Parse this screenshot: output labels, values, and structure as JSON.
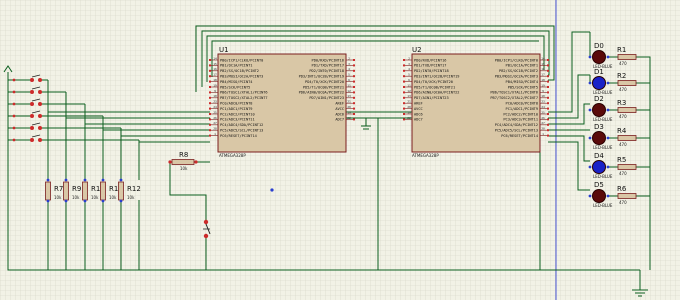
{
  "schematic": {
    "mcu1": {
      "ref": "U1",
      "part": "ATMEGA328P",
      "left_pins": [
        {
          "no": "14",
          "name": "PB0/ICP1/CLKO/PCINT0"
        },
        {
          "no": "15",
          "name": "PB1/OC1A/PCINT1"
        },
        {
          "no": "16",
          "name": "PB2/SS/OC1B/PCINT2"
        },
        {
          "no": "17",
          "name": "PB3/MOSI/OC2A/PCINT3"
        },
        {
          "no": "18",
          "name": "PB4/MISO/PCINT4"
        },
        {
          "no": "19",
          "name": "PB5/SCK/PCINT5"
        },
        {
          "no": "9",
          "name": "PB6/TOSC1/XTAL1/PCINT6"
        },
        {
          "no": "10",
          "name": "PB7/TOSC2/XTAL2/PCINT7"
        },
        {
          "no": "23",
          "name": "PC0/ADC0/PCINT8"
        },
        {
          "no": "24",
          "name": "PC1/ADC1/PCINT9"
        },
        {
          "no": "25",
          "name": "PC2/ADC2/PCINT10"
        },
        {
          "no": "26",
          "name": "PC3/ADC3/PCINT11"
        },
        {
          "no": "27",
          "name": "PC4/ADC4/SDA/PCINT12"
        },
        {
          "no": "28",
          "name": "PC5/ADC5/SCL/PCINT13"
        },
        {
          "no": "1",
          "name": "PC6/RESET/PCINT14"
        }
      ],
      "right_pins": [
        {
          "no": "2",
          "name": "PD0/RXD/PCINT16"
        },
        {
          "no": "3",
          "name": "PD1/TXD/PCINT17"
        },
        {
          "no": "4",
          "name": "PD2/INT0/PCINT18"
        },
        {
          "no": "5",
          "name": "PD3/INT1/OC2B/PCINT19"
        },
        {
          "no": "6",
          "name": "PD4/T0/XCK/PCINT20"
        },
        {
          "no": "11",
          "name": "PD5/T1/OC0B/PCINT21"
        },
        {
          "no": "12",
          "name": "PD6/AIN0/OC0A/PCINT22"
        },
        {
          "no": "13",
          "name": "PD7/AIN1/PCINT23"
        },
        {
          "no": "21",
          "name": "AREF"
        },
        {
          "no": "20",
          "name": "AVCC"
        },
        {
          "no": "19",
          "name": "ADC6"
        },
        {
          "no": "22",
          "name": "ADC7"
        }
      ]
    },
    "mcu2": {
      "ref": "U2",
      "part": "ATMEGA328P",
      "left_pins": [
        {
          "no": "2",
          "name": "PD0/RXD/PCINT16"
        },
        {
          "no": "3",
          "name": "PD1/TXD/PCINT17"
        },
        {
          "no": "4",
          "name": "PD2/INT0/PCINT18"
        },
        {
          "no": "5",
          "name": "PD3/INT1/OC2B/PCINT19"
        },
        {
          "no": "6",
          "name": "PD4/T0/XCK/PCINT20"
        },
        {
          "no": "11",
          "name": "PD5/T1/OC0B/PCINT21"
        },
        {
          "no": "12",
          "name": "PD6/AIN0/OC0A/PCINT22"
        },
        {
          "no": "13",
          "name": "PD7/AIN1/PCINT23"
        },
        {
          "no": "21",
          "name": "AREF"
        },
        {
          "no": "20",
          "name": "AVCC"
        },
        {
          "no": "19",
          "name": "ADC6"
        },
        {
          "no": "22",
          "name": "ADC7"
        }
      ],
      "right_pins": [
        {
          "no": "14",
          "name": "PB0/ICP1/CLKO/PCINT0"
        },
        {
          "no": "15",
          "name": "PB1/OC1A/PCINT1"
        },
        {
          "no": "16",
          "name": "PB2/SS/OC1B/PCINT2"
        },
        {
          "no": "17",
          "name": "PB3/MOSI/OC2A/PCINT3"
        },
        {
          "no": "18",
          "name": "PB4/MISO/PCINT4"
        },
        {
          "no": "19",
          "name": "PB5/SCK/PCINT5"
        },
        {
          "no": "9",
          "name": "PB6/TOSC1/XTAL1/PCINT6"
        },
        {
          "no": "10",
          "name": "PB7/TOSC2/XTAL2/PCINT7"
        },
        {
          "no": "23",
          "name": "PC0/ADC0/PCINT8"
        },
        {
          "no": "24",
          "name": "PC1/ADC1/PCINT9"
        },
        {
          "no": "25",
          "name": "PC2/ADC2/PCINT10"
        },
        {
          "no": "26",
          "name": "PC3/ADC3/PCINT11"
        },
        {
          "no": "27",
          "name": "PC4/ADC4/SDA/PCINT12"
        },
        {
          "no": "28",
          "name": "PC5/ADC5/SCL/PCINT13"
        },
        {
          "no": "1",
          "name": "PC6/RESET/PCINT14"
        }
      ]
    },
    "leds": [
      {
        "ref": "D0",
        "part": "LED-BLUE",
        "res": "R1",
        "res_val": "470"
      },
      {
        "ref": "D1",
        "part": "LED-BLUE",
        "res": "R2",
        "res_val": "470"
      },
      {
        "ref": "D2",
        "part": "LED-BLUE",
        "res": "R3",
        "res_val": "470"
      },
      {
        "ref": "D3",
        "part": "LED-BLUE",
        "res": "R4",
        "res_val": "470"
      },
      {
        "ref": "D4",
        "part": "LED-BLUE",
        "res": "R5",
        "res_val": "470"
      },
      {
        "ref": "D5",
        "part": "LED-BLUE",
        "res": "R6",
        "res_val": "470"
      }
    ],
    "pulldowns": [
      {
        "ref": "R7",
        "val": "10k"
      },
      {
        "ref": "R9",
        "val": "10k"
      },
      {
        "ref": "R10",
        "val": "10k"
      },
      {
        "ref": "R11",
        "val": "10k"
      },
      {
        "ref": "R12",
        "val": "10k"
      }
    ],
    "r8": {
      "ref": "R8",
      "val": "10k"
    },
    "colors": {
      "background": "#f2f2e6",
      "grid": "#d3d3c3",
      "wire": "#0b5e1e",
      "body": "#d9c7a6",
      "outline": "#7a1e1e",
      "led_on": "#1a22c8",
      "led_off": "#5a0a0a",
      "pin_red": "#cc2b2b",
      "pin_blue": "#2a3fd0"
    },
    "icons": [
      "power-arrow-icon",
      "ground-icon",
      "pushbutton-icon",
      "led-icon",
      "resistor-icon",
      "cursor-cross-icon"
    ]
  }
}
